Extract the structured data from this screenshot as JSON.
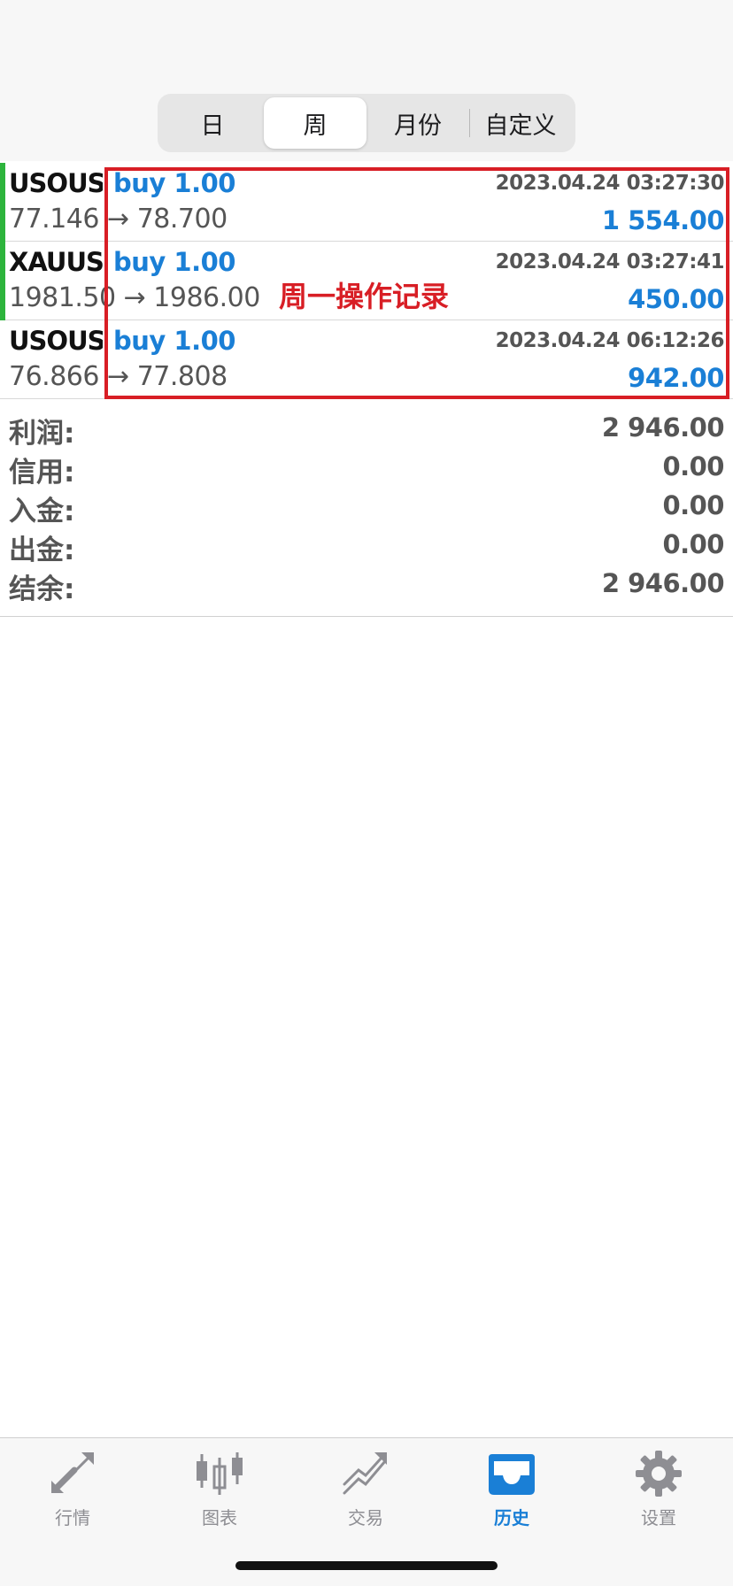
{
  "tabs": {
    "day": "日",
    "week": "周",
    "month": "月份",
    "custom": "自定义"
  },
  "trades": [
    {
      "symbol": "USOUSD,",
      "side": "buy 1.00",
      "time": "2023.04.24 03:27:30",
      "open_price": "77.146",
      "close_price": "78.700",
      "profit": "1 554.00"
    },
    {
      "symbol": "XAUUSD,",
      "side": "buy 1.00",
      "time": "2023.04.24 03:27:41",
      "open_price": "1981.50",
      "close_price": "1986.00",
      "profit": "450.00"
    },
    {
      "symbol": "USOUSD,",
      "side": "buy 1.00",
      "time": "2023.04.24 06:12:26",
      "open_price": "76.866",
      "close_price": "77.808",
      "profit": "942.00"
    }
  ],
  "price_arrow": "→",
  "annotation": "周一操作记录",
  "summary": {
    "profit_label": "利润:",
    "profit_value": "2 946.00",
    "credit_label": "信用:",
    "credit_value": "0.00",
    "deposit_label": "入金:",
    "deposit_value": "0.00",
    "withdrawal_label": "出金:",
    "withdrawal_value": "0.00",
    "balance_label": "结余:",
    "balance_value": "2 946.00"
  },
  "bottom_nav": {
    "quotes": "行情",
    "charts": "图表",
    "trade": "交易",
    "history": "历史",
    "settings": "设置"
  },
  "colors": {
    "accent_blue": "#1a7fd6",
    "buy_green": "#2db43c",
    "annotation_red": "#d81e25"
  }
}
